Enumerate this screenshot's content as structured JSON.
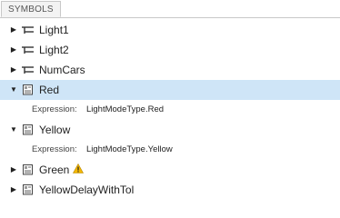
{
  "tab": {
    "label": "SYMBOLS"
  },
  "symbols": [
    {
      "name": "Light1",
      "icon": "data-port-icon",
      "expanded": false,
      "selected": false,
      "warning": false
    },
    {
      "name": "Light2",
      "icon": "data-port-icon",
      "expanded": false,
      "selected": false,
      "warning": false
    },
    {
      "name": "NumCars",
      "icon": "data-port-icon",
      "expanded": false,
      "selected": false,
      "warning": false
    },
    {
      "name": "Red",
      "icon": "constant-icon",
      "expanded": true,
      "selected": true,
      "warning": false,
      "expression_label": "Expression:",
      "expression_value": "LightModeType.Red"
    },
    {
      "name": "Yellow",
      "icon": "constant-icon",
      "expanded": true,
      "selected": false,
      "warning": false,
      "expression_label": "Expression:",
      "expression_value": "LightModeType.Yellow"
    },
    {
      "name": "Green",
      "icon": "constant-icon",
      "expanded": false,
      "selected": false,
      "warning": true
    },
    {
      "name": "YellowDelayWithTol",
      "icon": "constant-icon",
      "expanded": false,
      "selected": false,
      "warning": false
    }
  ],
  "colors": {
    "selection": "#cfe5f7",
    "warning": "#f5b800",
    "icon_stroke": "#333333"
  }
}
